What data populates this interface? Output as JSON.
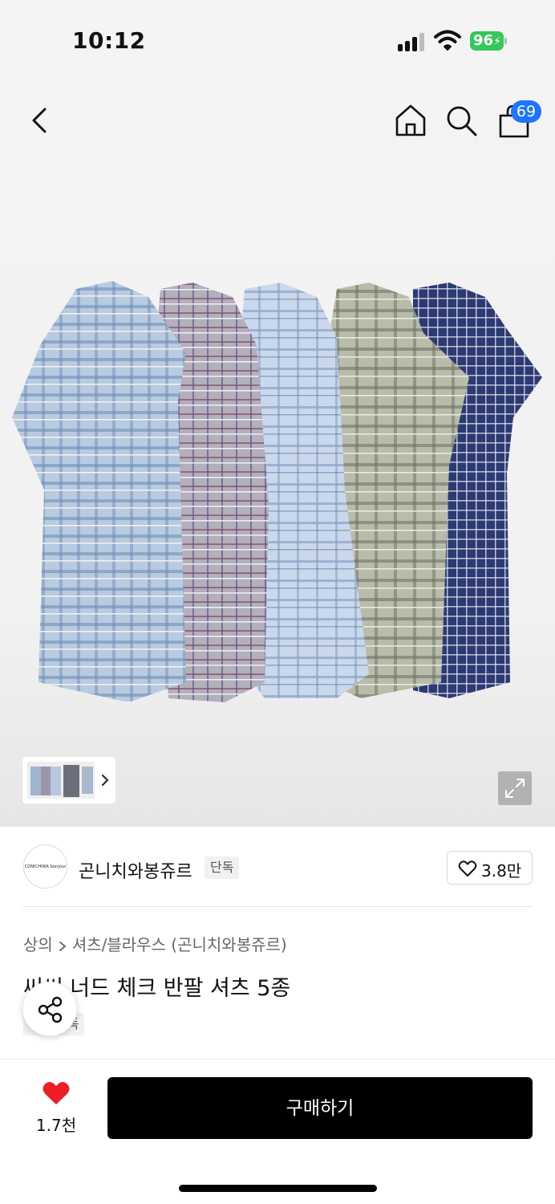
{
  "status_bar": {
    "time": "10:12",
    "battery": "96",
    "icons": [
      "signal-icon",
      "wifi-icon",
      "battery-icon"
    ]
  },
  "nav": {
    "cart_badge": "69",
    "icons": [
      "back-icon",
      "home-icon",
      "search-icon",
      "cart-icon"
    ]
  },
  "gallery": {
    "shirt_colors": [
      "#8fa9c6",
      "#8e8296",
      "#a7bcd8",
      "#9ea190",
      "#2f3a6b"
    ],
    "thumbnail_icon": "chevron-right-icon",
    "expand_icon": "expand-icon"
  },
  "brand": {
    "logo_text": "CONICHIWA bonjour",
    "name": "곤니치와봉쥬르",
    "tag": "단독",
    "likes": "3.8만"
  },
  "product": {
    "breadcrumb": [
      "상의",
      "셔츠/블라우스 (곤니치와봉쥬르)"
    ],
    "title": "씨씨 너드 체크 반팔 셔츠 5종",
    "tag": "단독"
  },
  "bottom_bar": {
    "wish_count": "1.7천",
    "buy_label": "구매하기",
    "accent": "#ee1c25"
  }
}
